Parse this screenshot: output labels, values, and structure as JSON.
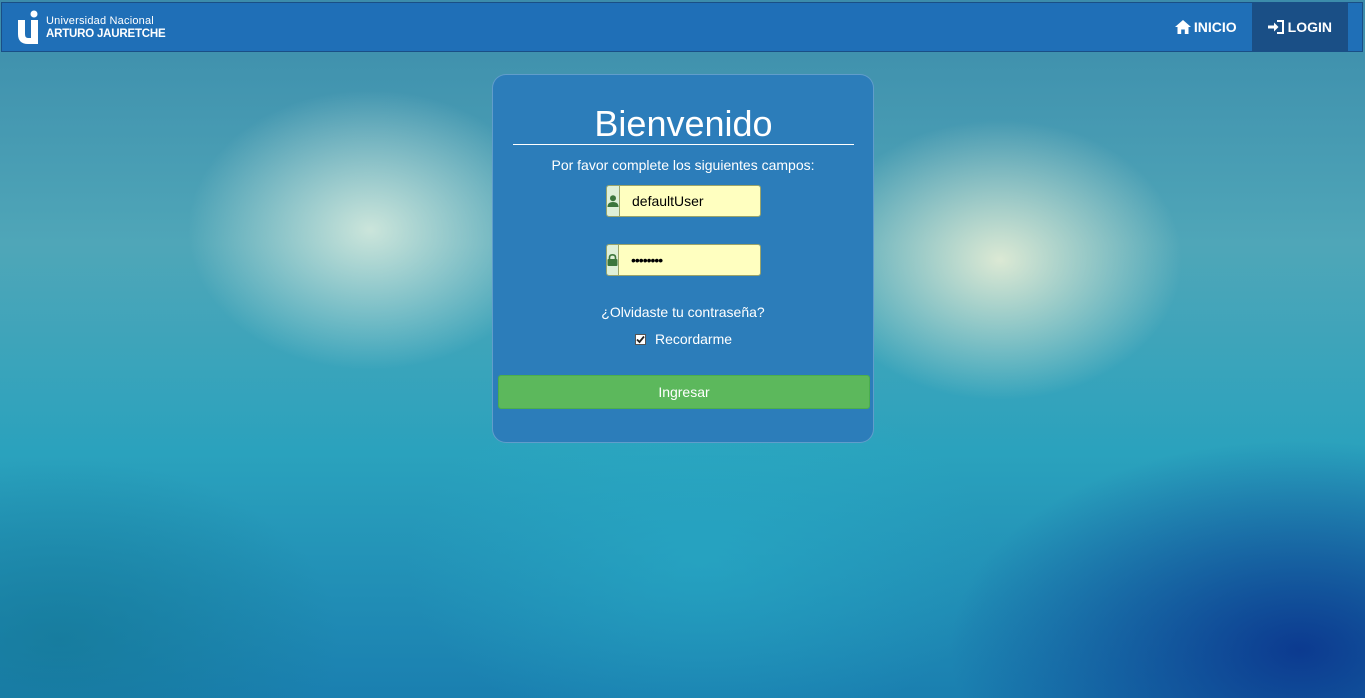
{
  "navbar": {
    "brand": {
      "line1": "Universidad Nacional",
      "line2": "ARTURO JAURETCHE"
    },
    "items": [
      {
        "label": "INICIO",
        "icon": "home-icon"
      },
      {
        "label": "LOGIN",
        "icon": "login-icon",
        "active": true
      }
    ]
  },
  "login": {
    "title": "Bienvenido",
    "subtitle": "Por favor complete los siguientes campos:",
    "username": {
      "value": "defaultUser",
      "icon": "user-icon"
    },
    "password": {
      "value": "••••••••",
      "icon": "lock-icon"
    },
    "forgot_label": "¿Olvidaste tu contraseña?",
    "remember_label": "Recordarme",
    "remember_checked": true,
    "submit_label": "Ingresar"
  },
  "colors": {
    "navbar": "#1f6fb7",
    "panel": "#2c7dba",
    "submit": "#5cb85c",
    "field": "#ffffc0"
  }
}
